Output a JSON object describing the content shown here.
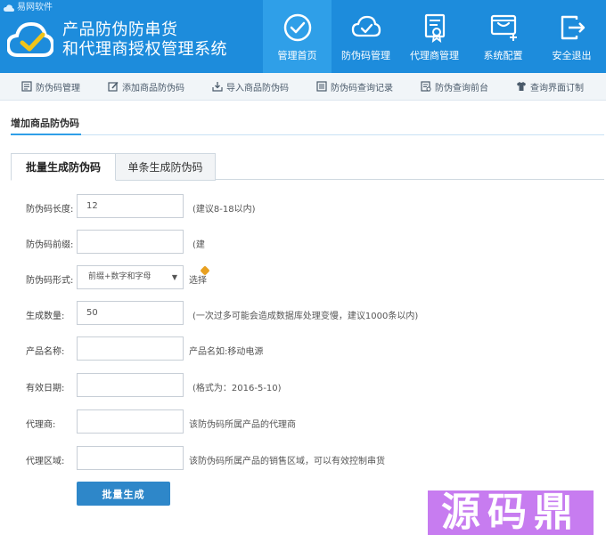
{
  "app": {
    "corner_label": "易网软件",
    "title_line1": "产品防伪防串货",
    "title_line2": "和代理商授权管理系统"
  },
  "nav": [
    {
      "label": "管理首页",
      "icon": "check-circle-icon",
      "active": true
    },
    {
      "label": "防伪码管理",
      "icon": "cloud-check-icon",
      "active": false
    },
    {
      "label": "代理商管理",
      "icon": "certificate-icon",
      "active": false
    },
    {
      "label": "系统配置",
      "icon": "monitor-config-icon",
      "active": false
    },
    {
      "label": "安全退出",
      "icon": "logout-icon",
      "active": false
    }
  ],
  "subnav": [
    {
      "label": "防伪码管理",
      "icon": "list-icon"
    },
    {
      "label": "添加商品防伪码",
      "icon": "edit-icon"
    },
    {
      "label": "导入商品防伪码",
      "icon": "import-icon"
    },
    {
      "label": "防伪码查询记录",
      "icon": "record-icon"
    },
    {
      "label": "防伪查询前台",
      "icon": "frontend-icon"
    },
    {
      "label": "查询界面订制",
      "icon": "shirt-icon"
    }
  ],
  "section_title": "增加商品防伪码",
  "tabs": {
    "batch": "批量生成防伪码",
    "single": "单条生成防伪码"
  },
  "form": {
    "code_length": {
      "label": "防伪码长度:",
      "value": "12",
      "hint": "(建议8-18以内)"
    },
    "prefix": {
      "label": "防伪码前缀:",
      "value": "",
      "hint": "(建"
    },
    "format": {
      "label": "防伪码形式:",
      "value": "前缀+数字和字母",
      "hint": "选择"
    },
    "quantity": {
      "label": "生成数量:",
      "value": "50",
      "hint": "(一次过多可能会造成数据库处理变慢，建议1000条以内)"
    },
    "product_name": {
      "label": "产品名称:",
      "value": "",
      "hint": "产品名如:移动电源"
    },
    "expiry_date": {
      "label": "有效日期:",
      "value": "",
      "hint": "(格式为：2016-5-10)"
    },
    "agent": {
      "label": "代理商:",
      "value": "",
      "hint": "该防伪码所属产品的代理商"
    },
    "region": {
      "label": "代理区域:",
      "value": "",
      "hint": "该防伪码所属产品的销售区域，可以有效控制串货"
    }
  },
  "submit_label": "批量生成",
  "watermark_text": "源码鼎",
  "colors": {
    "header": "#1d8cdc",
    "nav_active": "#2f9fe8",
    "button": "#2e87c9",
    "watermark": "#c77cf0"
  }
}
